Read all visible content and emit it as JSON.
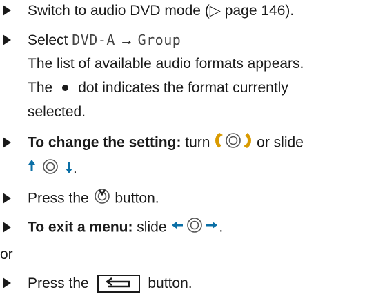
{
  "lines": {
    "l1": {
      "pre": "Switch to audio DVD mode (",
      "ref": "▷ page 146",
      "post": ")."
    },
    "l2": {
      "pre": "Select ",
      "mono1": "DVD-A",
      "arrow": " → ",
      "mono2": "Group",
      "post": "."
    },
    "l3": {
      "text": "The list of available audio formats appears."
    },
    "l4": {
      "pre": "The",
      "post": "dot indicates the format currently"
    },
    "l5": {
      "text": "selected."
    },
    "l6": {
      "bold": "To change the setting:",
      "mid": " turn ",
      "post": " or slide"
    },
    "l7": {
      "post": "."
    },
    "l8": {
      "pre": "Press the ",
      "post": " button."
    },
    "l9": {
      "bold": "To exit a menu:",
      "mid": " slide ",
      "post": "."
    },
    "l10": {
      "text": "or"
    },
    "l11": {
      "pre": "Press the ",
      "post": " button."
    }
  },
  "icons": {
    "rotate": "controller-rotate-icon",
    "slide_updown": "controller-slide-up-down-icon",
    "press": "controller-press-icon",
    "slide_leftright": "controller-slide-left-right-icon",
    "back": "back-button-icon"
  }
}
